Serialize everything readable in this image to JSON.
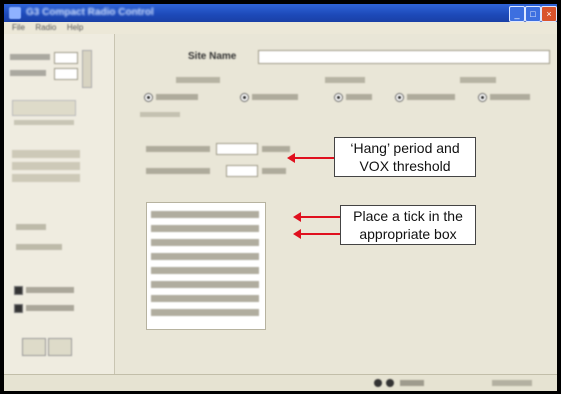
{
  "window": {
    "title": "G3 Compact Radio Control"
  },
  "menu": [
    "File",
    "Radio",
    "Help"
  ],
  "main": {
    "site_name_label": "Site Name",
    "callouts": {
      "hang_line1": "‘Hang’ period and",
      "hang_line2": "VOX threshold",
      "tick_line1": "Place a tick in the",
      "tick_line2": "appropriate box"
    }
  },
  "colors": {
    "arrow": "#e0101e",
    "titlebar": "#1d49b8"
  }
}
